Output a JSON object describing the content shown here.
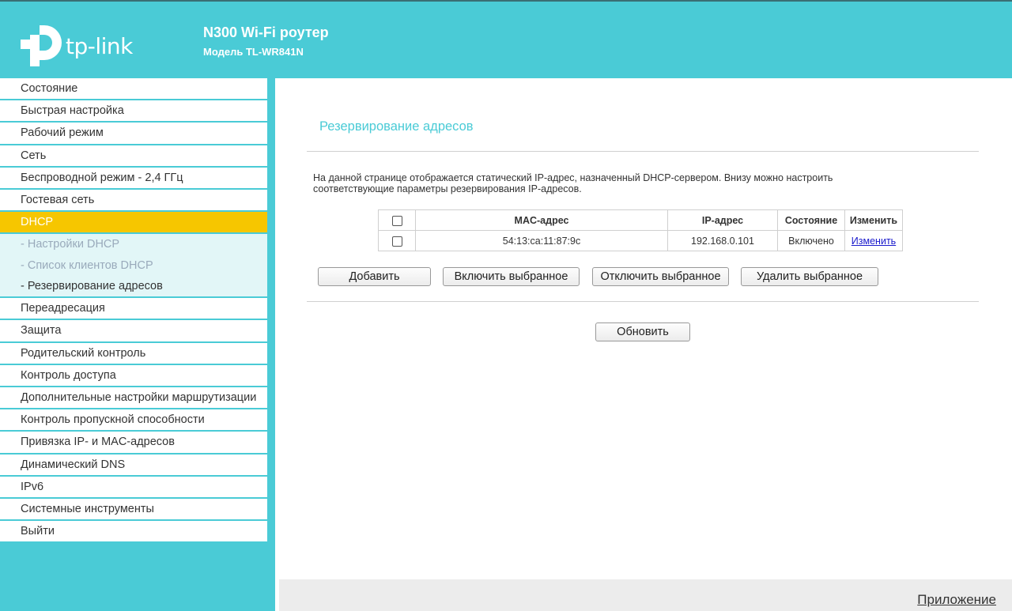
{
  "header": {
    "logo_text": "tp-link",
    "product": "N300 Wi-Fi роутер",
    "model": "Модель TL-WR841N"
  },
  "colors": {
    "brand": "#4acbd6",
    "active": "#f6c600"
  },
  "sidebar": {
    "items_top": [
      "Состояние",
      "Быстрая настройка",
      "Рабочий режим",
      "Сеть",
      "Беспроводной режим - 2,4 ГГц",
      "Гостевая сеть"
    ],
    "active": "DHCP",
    "sub": [
      "- Настройки DHCP",
      "- Список клиентов DHCP",
      "- Резервирование адресов"
    ],
    "items_bottom": [
      "Переадресация",
      "Защита",
      "Родительский контроль",
      "Контроль доступа",
      "Дополнительные настройки маршрутизации",
      "Контроль пропускной способности",
      "Привязка IP- и MAC-адресов",
      "Динамический DNS",
      "IPv6",
      "Системные инструменты",
      "Выйти"
    ]
  },
  "main": {
    "title": "Резервирование адресов",
    "description": "На данной странице отображается статический IP-адрес, назначенный DHCP-сервером. Внизу можно настроить соответствующие параметры резервирования IP-адресов.",
    "table": {
      "headers": [
        "MAC-адрес",
        "IP-адрес",
        "Состояние",
        "Изменить"
      ],
      "rows": [
        {
          "mac": "54:13:ca:11:87:9c",
          "ip": "192.168.0.101",
          "status": "Включено",
          "edit": "Изменить"
        }
      ]
    },
    "buttons": {
      "add": "Добавить",
      "enable": "Включить выбранное",
      "disable": "Отключить выбранное",
      "delete": "Удалить выбранное",
      "refresh": "Обновить"
    }
  },
  "footer": {
    "link": "Приложение"
  }
}
